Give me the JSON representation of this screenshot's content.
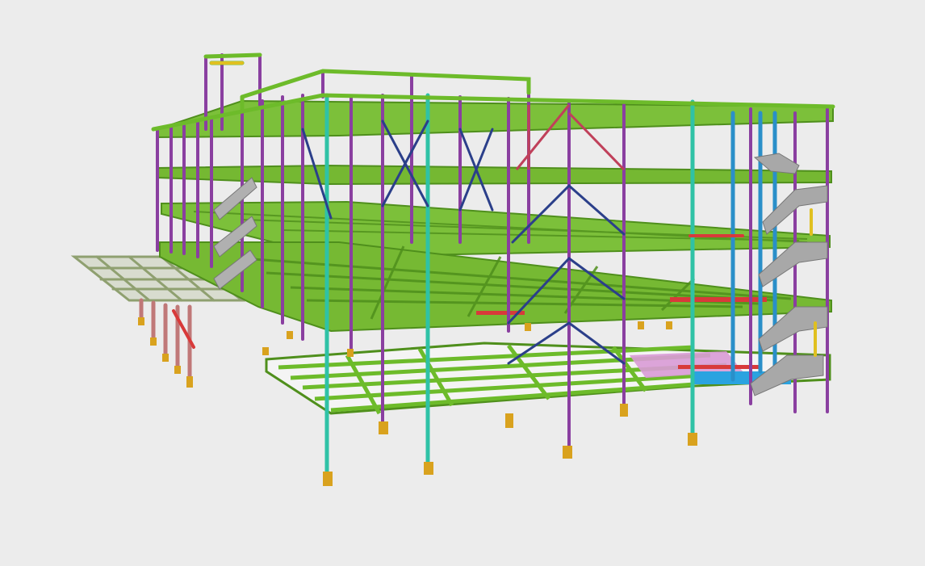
{
  "viewport": {
    "background": "#ececec",
    "content": "3d-steel-frame-model"
  },
  "palette": {
    "beam": "#6dbb2a",
    "beam_edge": "#4f8f1c",
    "column": "#8a3fa0",
    "column_alt": "#2fc2a6",
    "column_blue": "#2a8fc9",
    "brace": "#2b3f8a",
    "brace_red": "#c0405a",
    "base_plate": "#d9a21e",
    "stair": "#a8a8a8",
    "deck_pink": "#d99bd6",
    "deck_blue": "#2aa3e0",
    "misc_red": "#d83a3a",
    "misc_yellow": "#e0c020"
  }
}
